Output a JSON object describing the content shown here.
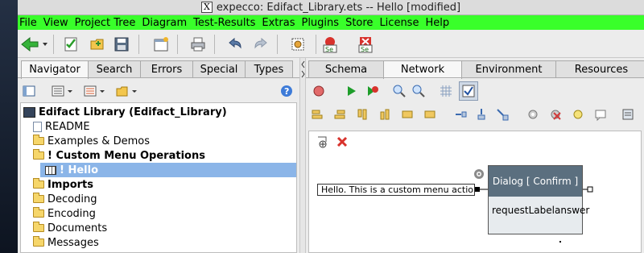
{
  "window": {
    "title": "expecco: Edifact_Library.ets -- Hello [modified]",
    "x_icon": "X"
  },
  "menu": [
    "File",
    "View",
    "Project Tree",
    "Diagram",
    "Test-Results",
    "Extras",
    "Plugins",
    "Store",
    "License",
    "Help"
  ],
  "left_tabs": [
    "Navigator",
    "Search",
    "Errors",
    "Special",
    "Types"
  ],
  "left_active_tab": "Navigator",
  "right_tabs": [
    "Schema",
    "Network",
    "Environment",
    "Resources"
  ],
  "right_active_tab": "Network",
  "tree": {
    "root": "Edifact Library (Edifact_Library)",
    "items": [
      {
        "label": "README",
        "icon": "document-icon"
      },
      {
        "label": "Examples & Demos",
        "icon": "folder-icon"
      },
      {
        "label": "! Custom Menu Operations",
        "icon": "folder-open-icon",
        "bold": true
      },
      {
        "label": "! Hello",
        "icon": "diagram-icon",
        "selected": true
      },
      {
        "label": "Imports",
        "icon": "folder-icon",
        "bold": true
      },
      {
        "label": "Decoding",
        "icon": "folder-icon"
      },
      {
        "label": "Encoding",
        "icon": "folder-icon"
      },
      {
        "label": "Documents",
        "icon": "folder-icon"
      },
      {
        "label": "Messages",
        "icon": "folder-icon"
      }
    ]
  },
  "diagram": {
    "block_title": "Dialog [ Confirm ]",
    "input_pin": "requestLabel",
    "output_pin": "answer",
    "constant": "Hello. This is a custom menu action"
  },
  "colors": {
    "menubar": "#39ff2a",
    "selection": "#8bb5e8",
    "block_header": "#5b6f7f"
  }
}
